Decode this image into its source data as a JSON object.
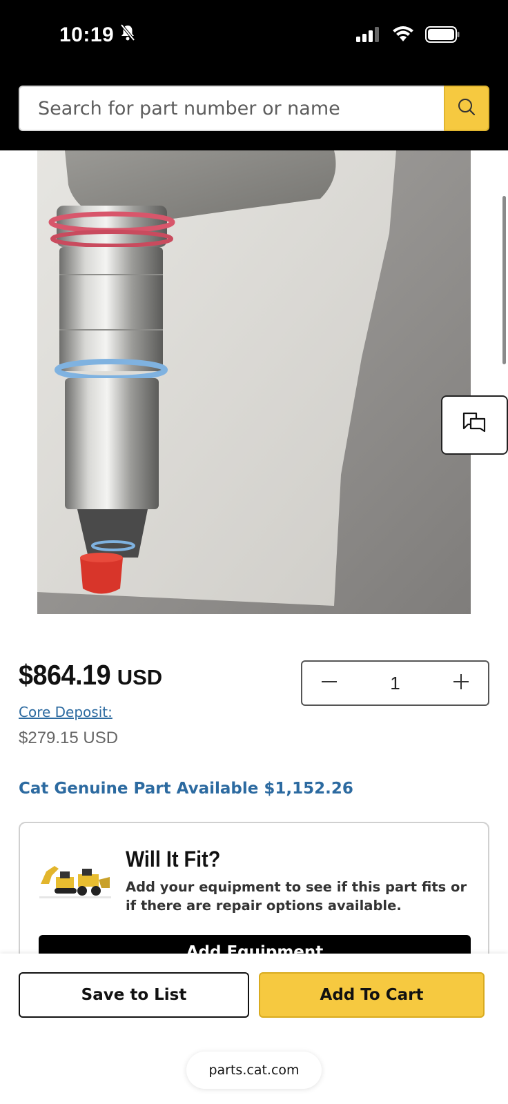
{
  "status_bar": {
    "time": "10:19",
    "icons": [
      "bell-slash-icon",
      "cellular-signal-icon",
      "wifi-icon",
      "battery-icon"
    ]
  },
  "search": {
    "placeholder": "Search for part number or name",
    "button_icon": "search-icon",
    "button_color": "#f6c940"
  },
  "product": {
    "image_description_icon": "fuel-injector-photo",
    "price_amount": "$864.19",
    "price_currency": "USD",
    "core_deposit_label": "Core Deposit:",
    "core_deposit_value": "$279.15 USD",
    "quantity": "1",
    "genuine_part_text": "Cat Genuine Part Available $1,152.26"
  },
  "fit": {
    "title": "Will It Fit?",
    "description": "Add your equipment to see if this part fits or if there are repair options available.",
    "button_label": "Add Equipment"
  },
  "actions": {
    "save_label": "Save to List",
    "cart_label": "Add To Cart"
  },
  "browser": {
    "url": "parts.cat.com"
  },
  "colors": {
    "brand_yellow": "#f6c940",
    "link_blue": "#2c6aa0",
    "header_black": "#000000"
  }
}
